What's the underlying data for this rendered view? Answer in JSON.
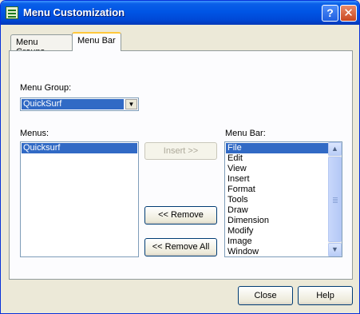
{
  "window": {
    "title": "Menu Customization",
    "help_glyph": "?",
    "close_glyph": "✕"
  },
  "tabs": [
    {
      "label": "Menu Groups",
      "selected": false
    },
    {
      "label": "Menu Bar",
      "selected": true
    }
  ],
  "menu_group": {
    "label": "Menu Group:",
    "value": "QuickSurf",
    "dropdown_glyph": "▼"
  },
  "menus": {
    "label": "Menus:",
    "items": [
      {
        "text": "Quicksurf",
        "selected": true
      }
    ]
  },
  "menu_bar": {
    "label": "Menu Bar:",
    "items": [
      {
        "text": "File",
        "selected": true
      },
      {
        "text": "Edit",
        "selected": false
      },
      {
        "text": "View",
        "selected": false
      },
      {
        "text": "Insert",
        "selected": false
      },
      {
        "text": "Format",
        "selected": false
      },
      {
        "text": "Tools",
        "selected": false
      },
      {
        "text": "Draw",
        "selected": false
      },
      {
        "text": "Dimension",
        "selected": false
      },
      {
        "text": "Modify",
        "selected": false
      },
      {
        "text": "Image",
        "selected": false
      },
      {
        "text": "Window",
        "selected": false
      }
    ],
    "scroll_up_glyph": "▲",
    "scroll_down_glyph": "▼"
  },
  "buttons": {
    "insert": "Insert >>",
    "remove": "<< Remove",
    "remove_all": "<< Remove All",
    "close": "Close",
    "help": "Help"
  },
  "colors": {
    "selection": "#316ac5",
    "titlebar": "#0055e5",
    "dialog_bg": "#ece9d8"
  }
}
